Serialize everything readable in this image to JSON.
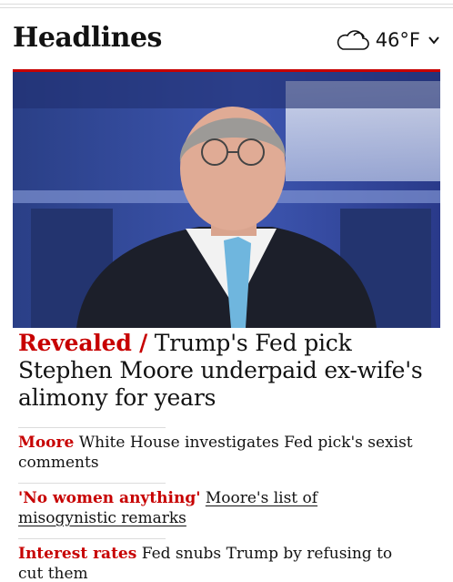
{
  "header": {
    "title": "Headlines",
    "weather": {
      "icon": "cloud-icon",
      "temperature": "46°F",
      "dropdown_icon": "chevron-down-icon"
    }
  },
  "hero": {
    "image_alt": "Man in a dark suit and blue tie on a television studio set"
  },
  "lead": {
    "kicker": "Revealed /",
    "headline": "Trump's Fed pick Stephen Moore underpaid ex-wife's alimony for years"
  },
  "sublinks": [
    {
      "kicker": "Moore",
      "text": "White House investigates Fed pick's sexist comments"
    },
    {
      "kicker": "'No women anything'",
      "text": "Moore's list of misogynistic remarks"
    },
    {
      "kicker": "Interest rates",
      "text": "Fed snubs Trump by refusing to cut them"
    }
  ],
  "colors": {
    "accent": "#c70000",
    "text": "#121212",
    "divider": "#dcdcdc"
  }
}
